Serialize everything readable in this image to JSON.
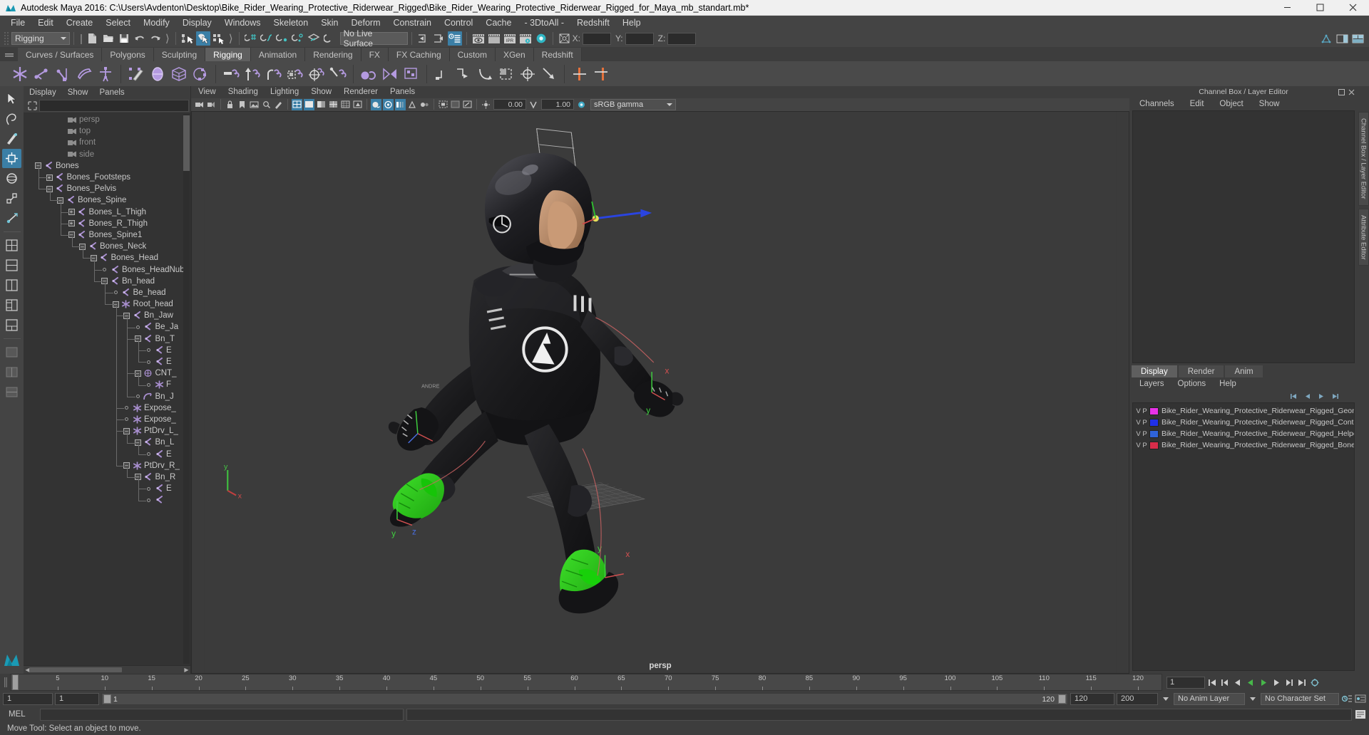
{
  "window": {
    "title": "Autodesk Maya 2016: C:\\Users\\Avdenton\\Desktop\\Bike_Rider_Wearing_Protective_Riderwear_Rigged\\Bike_Rider_Wearing_Protective_Riderwear_Rigged_for_Maya_mb_standart.mb*",
    "minimize": "–",
    "maximize": "❑",
    "close": "✕"
  },
  "menubar": {
    "items": [
      "File",
      "Edit",
      "Create",
      "Select",
      "Modify",
      "Display",
      "Windows",
      "Skeleton",
      "Skin",
      "Deform",
      "Constrain",
      "Control",
      "Cache",
      "- 3DtoAll -",
      "Redshift",
      "Help"
    ]
  },
  "statusline": {
    "menuset": "Rigging",
    "live_surface": "No Live Surface",
    "axis_x_label": "X:",
    "axis_y_label": "Y:",
    "axis_z_label": "Z:",
    "axis_x_value": "",
    "axis_y_value": "",
    "axis_z_value": "",
    "ipr_label": "IPR"
  },
  "shelf": {
    "tabs": [
      "Curves / Surfaces",
      "Polygons",
      "Sculpting",
      "Rigging",
      "Animation",
      "Rendering",
      "FX",
      "FX Caching",
      "Custom",
      "XGen",
      "Redshift"
    ],
    "active_tab": "Rigging"
  },
  "outliner": {
    "menus": [
      "Display",
      "Show",
      "Panels"
    ],
    "search_value": "",
    "search_placeholder": "",
    "rows": [
      {
        "depth": 2,
        "label": "persp",
        "icon": "camera-icon",
        "toggle": "none",
        "dim": true
      },
      {
        "depth": 2,
        "label": "top",
        "icon": "camera-icon",
        "toggle": "none",
        "dim": true
      },
      {
        "depth": 2,
        "label": "front",
        "icon": "camera-icon",
        "toggle": "none",
        "dim": true
      },
      {
        "depth": 2,
        "label": "side",
        "icon": "camera-icon",
        "toggle": "none",
        "dim": true
      },
      {
        "depth": 0,
        "label": "Bones",
        "icon": "joint-icon",
        "toggle": "minus",
        "dim": false
      },
      {
        "depth": 1,
        "label": "Bones_Footsteps",
        "icon": "joint-icon",
        "toggle": "plus",
        "dim": false
      },
      {
        "depth": 1,
        "label": "Bones_Pelvis",
        "icon": "joint-icon",
        "toggle": "minus",
        "dim": false
      },
      {
        "depth": 2,
        "label": "Bones_Spine",
        "icon": "joint-icon",
        "toggle": "minus",
        "dim": false
      },
      {
        "depth": 3,
        "label": "Bones_L_Thigh",
        "icon": "joint-icon",
        "toggle": "plus",
        "dim": false
      },
      {
        "depth": 3,
        "label": "Bones_R_Thigh",
        "icon": "joint-icon",
        "toggle": "plus",
        "dim": false
      },
      {
        "depth": 3,
        "label": "Bones_Spine1",
        "icon": "joint-icon",
        "toggle": "minus",
        "dim": false
      },
      {
        "depth": 4,
        "label": "Bones_Neck",
        "icon": "joint-icon",
        "toggle": "minus",
        "dim": false
      },
      {
        "depth": 5,
        "label": "Bones_Head",
        "icon": "joint-icon",
        "toggle": "minus",
        "dim": false
      },
      {
        "depth": 6,
        "label": "Bones_HeadNub",
        "icon": "joint-icon",
        "toggle": "leaf",
        "dim": false
      },
      {
        "depth": 6,
        "label": "Bn_head",
        "icon": "joint-icon",
        "toggle": "minus",
        "dim": false
      },
      {
        "depth": 7,
        "label": "Be_head",
        "icon": "joint-icon",
        "toggle": "leaf",
        "dim": false
      },
      {
        "depth": 7,
        "label": "Root_head",
        "icon": "star-icon",
        "toggle": "minus",
        "dim": false
      },
      {
        "depth": 8,
        "label": "Bn_Jaw",
        "icon": "joint-icon",
        "toggle": "minus",
        "dim": false
      },
      {
        "depth": 9,
        "label": "Be_Ja",
        "icon": "joint-icon",
        "toggle": "leaf",
        "dim": false
      },
      {
        "depth": 9,
        "label": "Bn_T",
        "icon": "joint-icon",
        "toggle": "minus",
        "dim": false
      },
      {
        "depth": 10,
        "label": "E",
        "icon": "joint-icon",
        "toggle": "leaf",
        "dim": false
      },
      {
        "depth": 10,
        "label": "E",
        "icon": "joint-icon",
        "toggle": "leaf",
        "dim": false
      },
      {
        "depth": 9,
        "label": "CNT_",
        "icon": "mesh-icon",
        "toggle": "minus",
        "dim": false
      },
      {
        "depth": 10,
        "label": "F",
        "icon": "star-icon",
        "toggle": "leaf",
        "dim": false
      },
      {
        "depth": 9,
        "label": "Bn_J",
        "icon": "curve-icon",
        "toggle": "leaf",
        "dim": false
      },
      {
        "depth": 8,
        "label": "Expose_",
        "icon": "star-icon",
        "toggle": "leaf",
        "dim": false
      },
      {
        "depth": 8,
        "label": "Expose_",
        "icon": "star-icon",
        "toggle": "leaf",
        "dim": false
      },
      {
        "depth": 8,
        "label": "PtDrv_L_",
        "icon": "star-icon",
        "toggle": "minus",
        "dim": false
      },
      {
        "depth": 9,
        "label": "Bn_L",
        "icon": "joint-icon",
        "toggle": "minus",
        "dim": false
      },
      {
        "depth": 10,
        "label": "E",
        "icon": "joint-icon",
        "toggle": "leaf",
        "dim": false
      },
      {
        "depth": 8,
        "label": "PtDrv_R_",
        "icon": "star-icon",
        "toggle": "minus",
        "dim": false
      },
      {
        "depth": 9,
        "label": "Bn_R",
        "icon": "joint-icon",
        "toggle": "minus",
        "dim": false
      },
      {
        "depth": 10,
        "label": "E",
        "icon": "joint-icon",
        "toggle": "leaf",
        "dim": false
      },
      {
        "depth": 10,
        "label": "",
        "icon": "joint-icon",
        "toggle": "leaf",
        "dim": false
      }
    ]
  },
  "viewport": {
    "menus": [
      "View",
      "Shading",
      "Lighting",
      "Show",
      "Renderer",
      "Panels"
    ],
    "exposure_value": "0.00",
    "gamma_value": "1.00",
    "color_profile": "sRGB gamma",
    "camera_label": "persp"
  },
  "channelbox": {
    "dock_title": "Channel Box / Layer Editor",
    "menus": [
      "Channels",
      "Edit",
      "Object",
      "Show"
    ]
  },
  "layereditor": {
    "tabs": [
      "Display",
      "Render",
      "Anim"
    ],
    "active_tab": "Display",
    "menus": [
      "Layers",
      "Options",
      "Help"
    ],
    "col_v": "V",
    "col_p": "P",
    "layers": [
      {
        "v": "V",
        "p": "P",
        "color": "#e832e8",
        "name": "Bike_Rider_Wearing_Protective_Riderwear_Rigged_Geom"
      },
      {
        "v": "V",
        "p": "P",
        "color": "#2030e8",
        "name": "Bike_Rider_Wearing_Protective_Riderwear_Rigged_Contr"
      },
      {
        "v": "V",
        "p": "P",
        "color": "#2f63d8",
        "name": "Bike_Rider_Wearing_Protective_Riderwear_Rigged_Helpe"
      },
      {
        "v": "V",
        "p": "P",
        "color": "#d82d4a",
        "name": "Bike_Rider_Wearing_Protective_Riderwear_Rigged_Bones"
      }
    ]
  },
  "right_tabs": [
    "Channel Box / Layer Editor",
    "Attribute Editor"
  ],
  "timeline": {
    "ticks": [
      "5",
      "10",
      "15",
      "20",
      "25",
      "30",
      "35",
      "40",
      "45",
      "50",
      "55",
      "60",
      "65",
      "70",
      "75",
      "80",
      "85",
      "90",
      "95",
      "100",
      "105",
      "110",
      "115",
      "120"
    ],
    "current_frame": "1",
    "current_frame_field": "1",
    "start_field": "1",
    "end_field": "1",
    "range_start": "1",
    "range_end": "120",
    "playback_end": "120",
    "anim_end": "200",
    "anim_layer": "No Anim Layer",
    "character_set": "No Character Set",
    "key_label": "1"
  },
  "mel": {
    "label": "MEL",
    "command": ""
  },
  "statusbar": {
    "text": "Move Tool: Select an object to move."
  },
  "colors": {
    "accent_blue": "#3b7fa6",
    "joint_purple": "#a98fd0",
    "panel_bg": "#3d3d3d",
    "viewport_bg": "#3b3b3b",
    "tree_bg": "#333333"
  }
}
